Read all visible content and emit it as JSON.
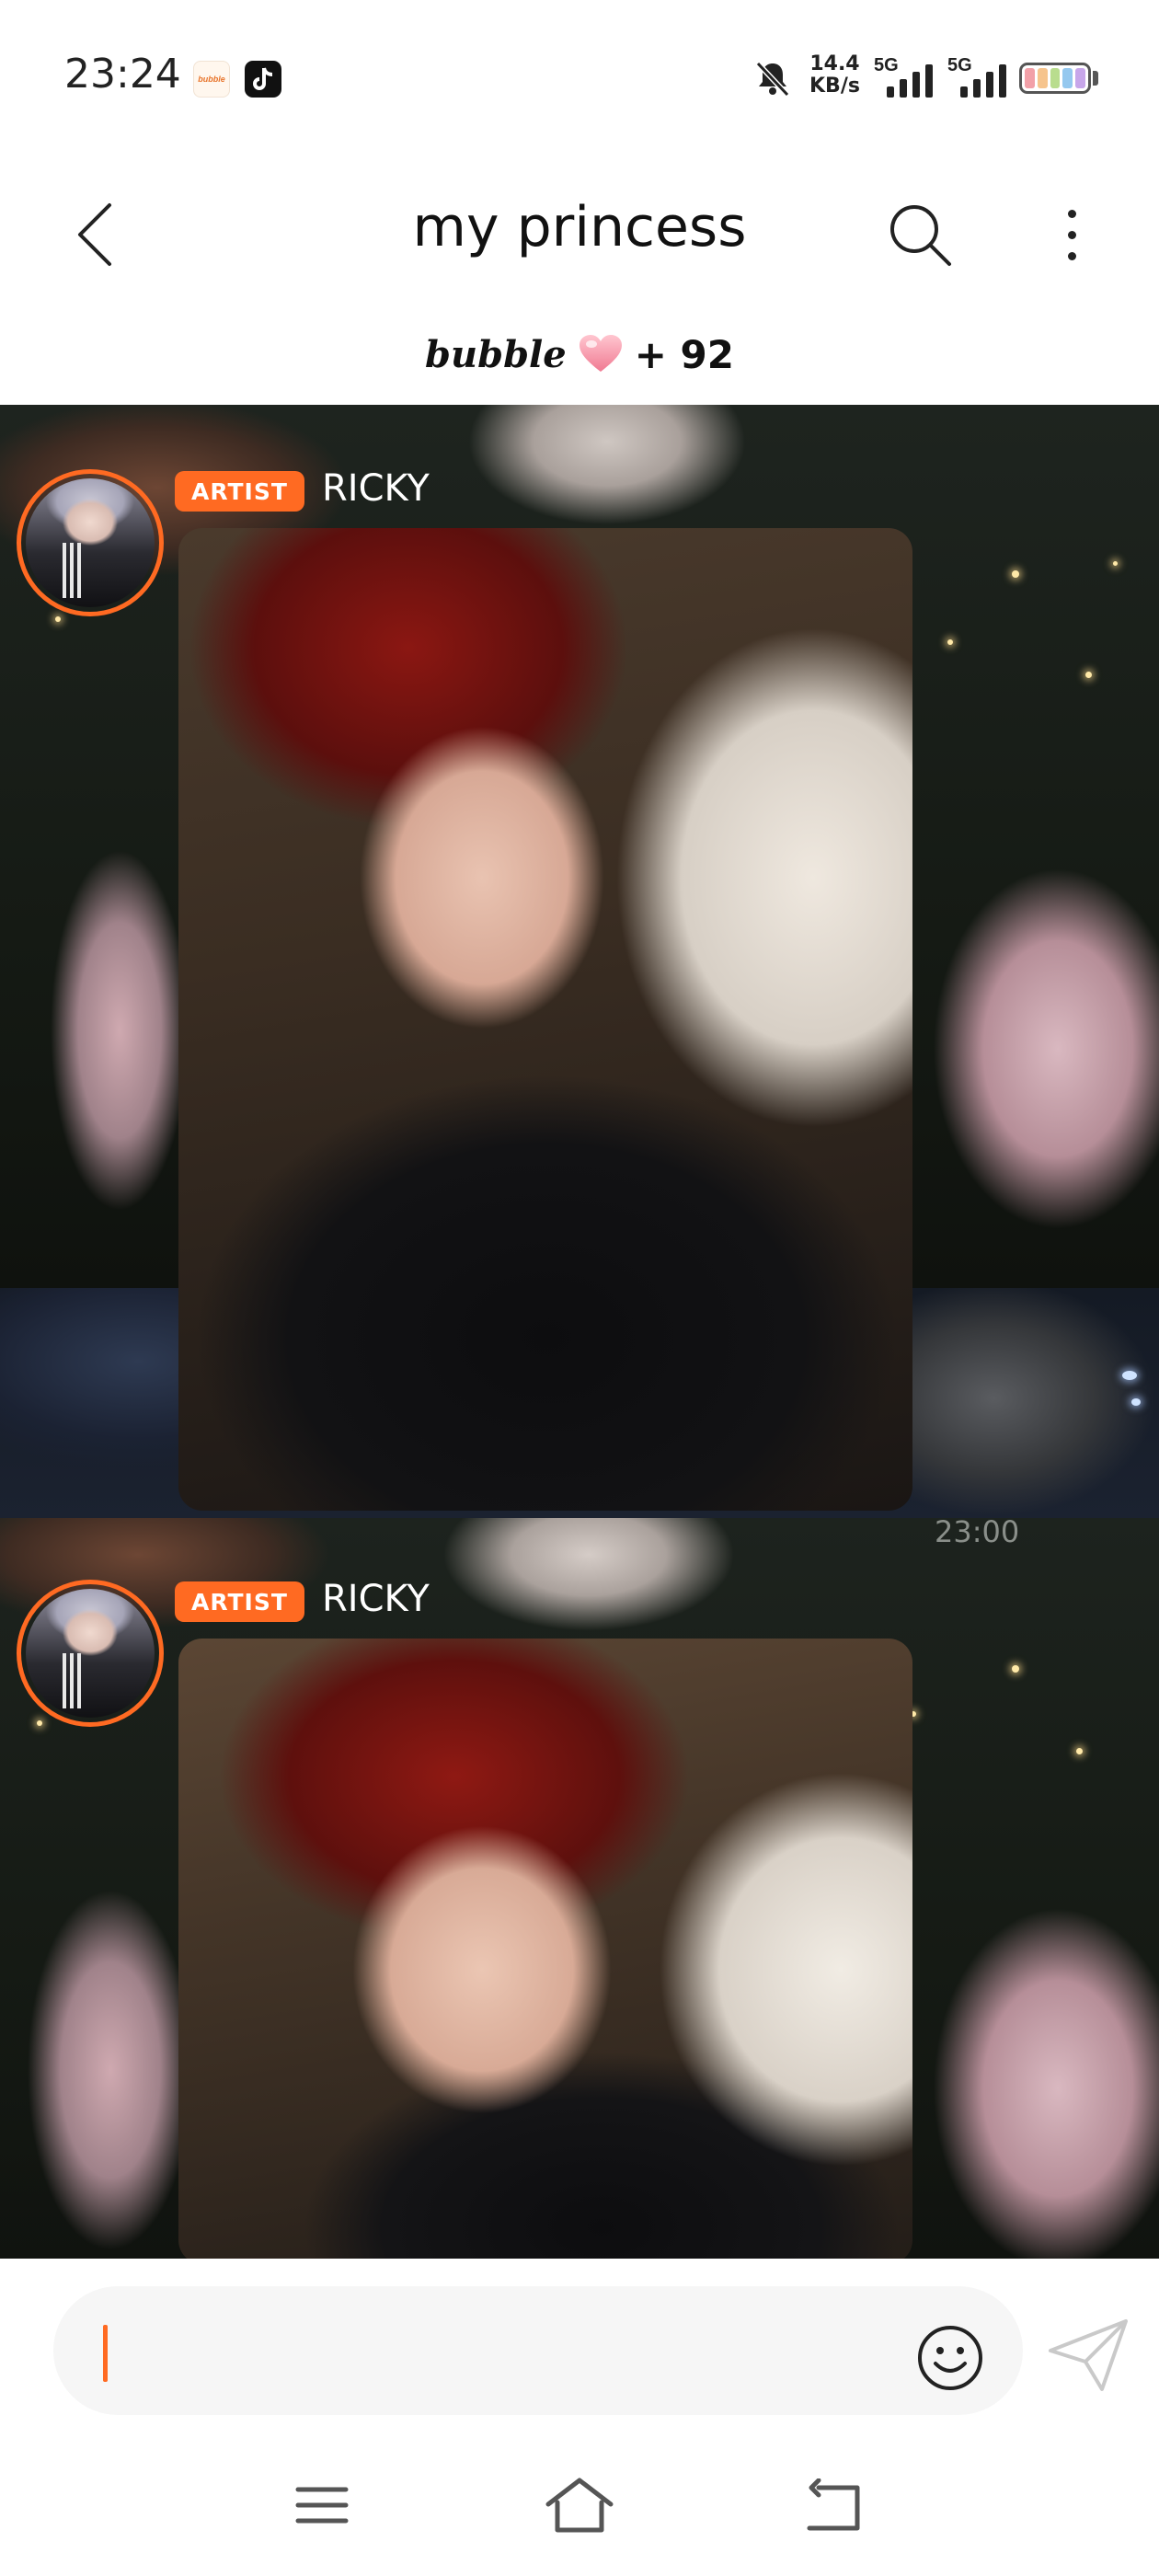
{
  "status_bar": {
    "time": "23:24",
    "app_badges": [
      "bubble",
      "tiktok"
    ],
    "net_speed_value": "14.4",
    "net_speed_unit": "KB/s",
    "signal_1_label": "5G",
    "signal_2_label": "5G",
    "icons": [
      "mute-bell-icon",
      "signal-icon",
      "battery-icon"
    ]
  },
  "header": {
    "title": "my princess",
    "bubble_label": "bubble",
    "bubble_count": "+ 92",
    "icons": [
      "back-arrow-icon",
      "search-icon",
      "more-vert-icon",
      "heart-icon"
    ]
  },
  "messages": [
    {
      "badge": "ARTIST",
      "sender": "RICKY",
      "type": "photo",
      "time": "23:00"
    },
    {
      "badge": "ARTIST",
      "sender": "RICKY",
      "type": "photo",
      "time": ""
    }
  ],
  "composer": {
    "value": "",
    "icons": [
      "emoji-icon",
      "send-icon"
    ]
  },
  "nav_bar": {
    "icons": [
      "menu-icon",
      "home-icon",
      "back-icon"
    ]
  },
  "colors": {
    "accent": "#ff6a22",
    "header_bg": "#ffffff",
    "timestamp": "#8a8f8a"
  }
}
